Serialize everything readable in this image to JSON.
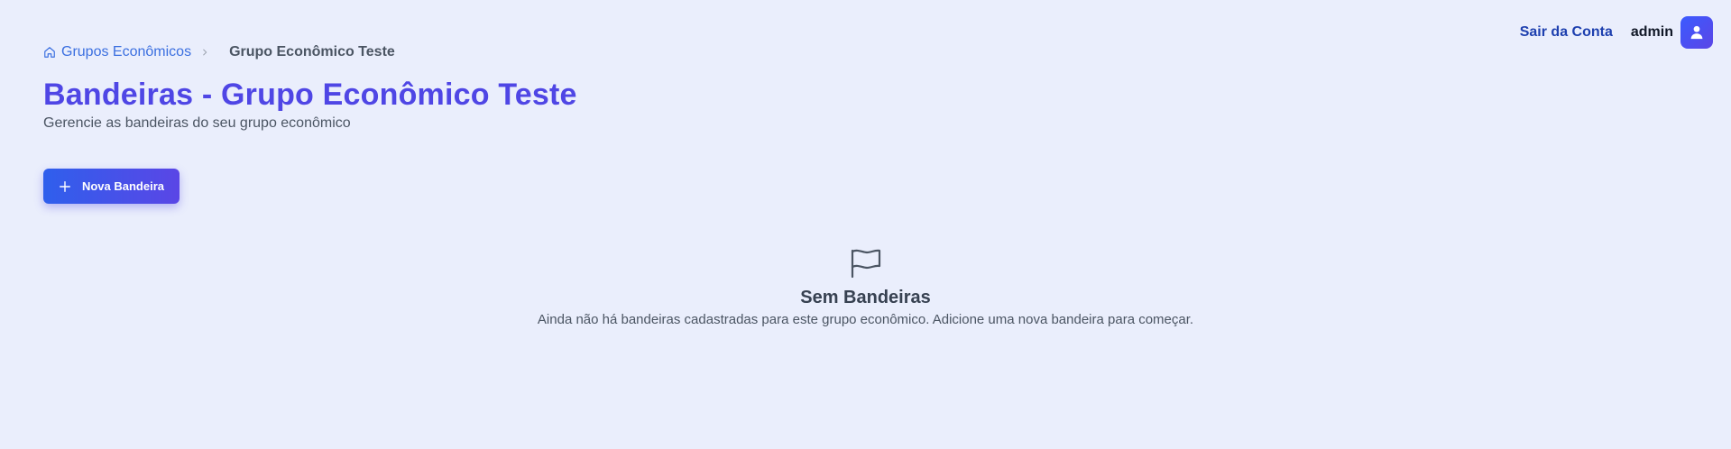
{
  "header": {
    "logout_label": "Sair da Conta",
    "username": "admin",
    "avatar_icon": "user-icon"
  },
  "breadcrumb": {
    "home_icon": "home-icon",
    "parent_label": "Grupos Econômicos",
    "current_label": "Grupo Econômico Teste"
  },
  "page": {
    "title": "Bandeiras - Grupo Econômico Teste",
    "subtitle": "Gerencie as bandeiras do seu grupo econômico"
  },
  "actions": {
    "new_button_label": "Nova Bandeira",
    "new_button_icon": "plus-icon"
  },
  "empty_state": {
    "icon": "flag-icon",
    "title": "Sem Bandeiras",
    "text": "Ainda não há bandeiras cadastradas para este grupo econômico. Adicione uma nova bandeira para começar."
  },
  "colors": {
    "background": "#eaeefc",
    "accent": "#4f46e5",
    "link": "#1e40af"
  }
}
